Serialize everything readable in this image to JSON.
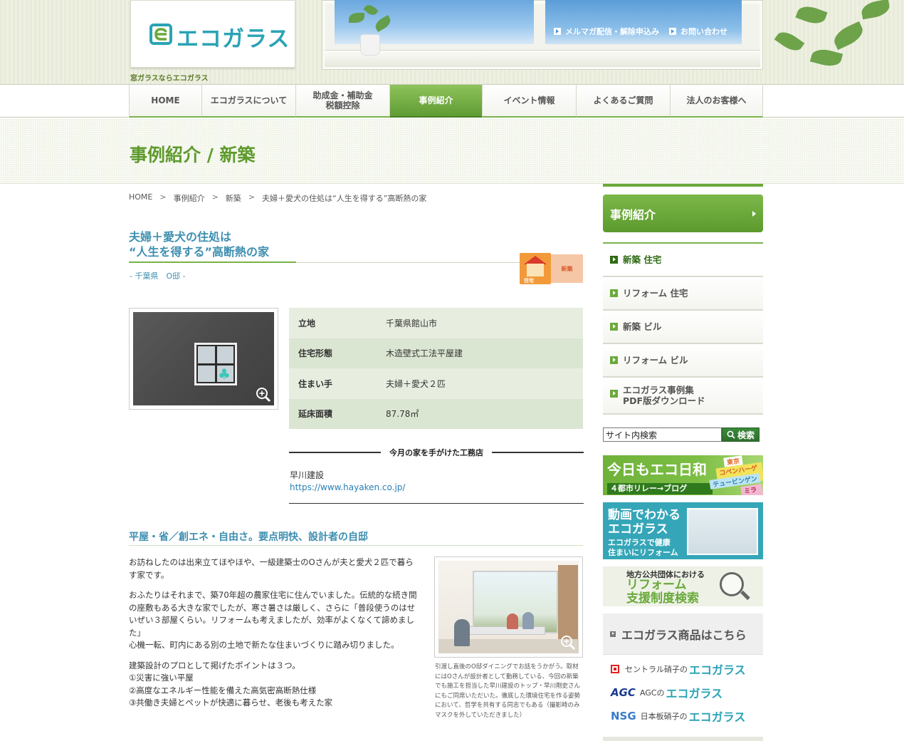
{
  "header": {
    "logo_text": "エコガラス",
    "tagline": "窓ガラスならエコガラス",
    "top_links": [
      "メルマガ配信・解除申込み",
      "お問い合わせ"
    ]
  },
  "nav": {
    "items": [
      {
        "label": "HOME",
        "active": false
      },
      {
        "label": "エコガラスについて",
        "active": false
      },
      {
        "label": "助成金・補助金\n税額控除",
        "active": false
      },
      {
        "label": "事例紹介",
        "active": true
      },
      {
        "label": "イベント情報",
        "active": false
      },
      {
        "label": "よくあるご質問",
        "active": false
      },
      {
        "label": "法人のお客様へ",
        "active": false
      }
    ]
  },
  "page_title": "事例紹介 / 新築",
  "breadcrumb": [
    "HOME",
    "事例紹介",
    "新築",
    "夫婦＋愛犬の住処は“人生を得する”高断熱の家"
  ],
  "article": {
    "title_line1": "夫婦＋愛犬の住処は",
    "title_line2": "“人生を得する”高断熱の家",
    "subtitle": "- 千葉県　O邸 -",
    "badge_house": "住宅",
    "badge_new": "新築"
  },
  "info": [
    {
      "key": "立地",
      "value": "千葉県館山市"
    },
    {
      "key": "住宅形態",
      "value": "木造壁式工法平屋建"
    },
    {
      "key": "住まい手",
      "value": "夫婦＋愛犬２匹"
    },
    {
      "key": "延床面積",
      "value": "87.78㎡"
    }
  ],
  "builder": {
    "heading": "今月の家を手がけた工務店",
    "name": "早川建設",
    "url": "https://www.hayaken.co.jp/"
  },
  "section": {
    "title": "平屋・省／創エネ・自由さ。要点明快、設計者の自邸",
    "paragraphs": [
      "お訪ねしたのは出来立てほやほや、一級建築士のOさんが夫と愛犬２匹で暮らす家です。",
      "おふたりはそれまで、築70年超の農家住宅に住んでいました。伝統的な続き間の座敷もある大きな家でしたが、寒さ暑さは厳しく、さらに「普段使うのはせいぜい３部屋くらい。リフォームも考えましたが、効率がよくなくて諦めました」\n心機一転、町内にある別の土地で新たな住まいづくりに踏み切りました。",
      "建築設計のプロとして掲げたポイントは３つ。\n①災害に強い平屋\n②高度なエネルギー性能を備えた高気密高断熱仕様\n③共働き夫婦とペットが快適に暮らせ、老後も考えた家"
    ],
    "caption": "引渡し直後のO邸ダイニングでお話をうかがう。取材にはOさんが設計者として勤務している、今回の新築でも施工を担当した早川建設のトップ・早川剛史さんにもご同席いただいた。徹底した環境住宅を作る姿勢において、哲学を共有する同志でもある（撮影時のみマスクを外していただきました）"
  },
  "sidebar": {
    "heading": "事例紹介",
    "items": [
      {
        "label": "新築 住宅",
        "active": true
      },
      {
        "label": "リフォーム 住宅",
        "active": false
      },
      {
        "label": "新築 ビル",
        "active": false
      },
      {
        "label": "リフォーム ビル",
        "active": false
      },
      {
        "label": "エコガラス事例集\nPDF版ダウンロード",
        "active": false
      }
    ],
    "search": {
      "value": "サイト内検索",
      "button": "検索"
    },
    "banner1": {
      "title": "今日もエコ日和",
      "sub": "４都市リレー→ブログ",
      "tags": [
        "東京",
        "コペンハーゲン",
        "テュービンゲン",
        "ミラノ"
      ]
    },
    "banner2": {
      "title": "動画でわかる\nエコガラス",
      "sub": "エコガラスで健康\n住まいにリフォーム"
    },
    "banner3": {
      "line1": "地方公共団体における",
      "line2": "リフォーム\n支援制度検索"
    },
    "banner4": "エコガラス商品はこちら",
    "brands": [
      {
        "prefix": "セントラル硝子の",
        "eco": "エコガラス"
      },
      {
        "logo": "AGC",
        "prefix": "AGCの",
        "eco": "エコガラス"
      },
      {
        "logo": "NSG",
        "prefix": "日本板硝子の",
        "eco": "エコガラス"
      }
    ]
  },
  "colors": {
    "brand_green": "#6aa93b",
    "title_blue": "#3e8fb0",
    "logo_teal": "#2aa3b5"
  }
}
